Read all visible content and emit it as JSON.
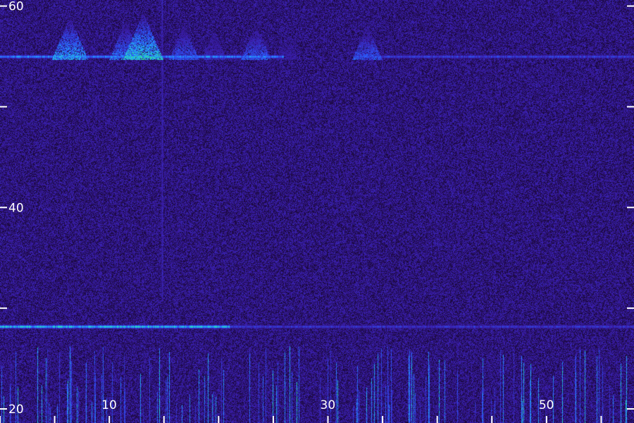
{
  "chart_data": {
    "type": "heatmap",
    "title": "",
    "xlabel": "",
    "ylabel": "",
    "xlim": [
      0,
      58
    ],
    "ylim": [
      20,
      62
    ],
    "x_ticks": [
      0,
      5,
      10,
      15,
      20,
      25,
      30,
      35,
      40,
      45,
      50,
      55
    ],
    "x_tick_labels": [
      {
        "x": 10,
        "label": "10"
      },
      {
        "x": 30,
        "label": "30"
      },
      {
        "x": 50,
        "label": "50"
      }
    ],
    "y_ticks": [
      20,
      30,
      40,
      50,
      60
    ],
    "y_tick_labels": [
      {
        "y": 20,
        "label": "20"
      },
      {
        "y": 40,
        "label": "40"
      },
      {
        "y": 60,
        "label": "60"
      }
    ],
    "colormap": [
      "#1a0838",
      "#3a1ca8",
      "#2a5cff",
      "#22c8e8",
      "#3cff50"
    ],
    "features": [
      {
        "kind": "band",
        "y": 55,
        "x_start": 0,
        "x_end": 26,
        "intensity": 0.75,
        "note_segments": "bursts"
      },
      {
        "kind": "band",
        "y": 55,
        "x_start": 32.5,
        "x_end": 58,
        "intensity": 0.5
      },
      {
        "kind": "band",
        "y": 28.2,
        "x_start": 0,
        "x_end": 21,
        "intensity": 0.95
      },
      {
        "kind": "band",
        "y": 28.2,
        "x_start": 21,
        "x_end": 58,
        "intensity": 0.45
      },
      {
        "kind": "vertical",
        "x": 14.8,
        "y_start": 31,
        "y_end": 62,
        "intensity": 0.35
      },
      {
        "kind": "burst",
        "x": 6.4,
        "y": 55,
        "intensity": 0.85
      },
      {
        "kind": "burst",
        "x": 11.5,
        "y": 55,
        "intensity": 0.7
      },
      {
        "kind": "burst",
        "x": 13.1,
        "y": 55,
        "intensity": 1.0
      },
      {
        "kind": "burst",
        "x": 16.8,
        "y": 55,
        "intensity": 0.6
      },
      {
        "kind": "burst",
        "x": 19.6,
        "y": 55,
        "intensity": 0.4
      },
      {
        "kind": "burst",
        "x": 23.4,
        "y": 55,
        "intensity": 0.6
      },
      {
        "kind": "burst",
        "x": 26.3,
        "y": 55,
        "intensity": 0.3
      },
      {
        "kind": "burst",
        "x": 33.6,
        "y": 55,
        "intensity": 0.6
      }
    ]
  }
}
